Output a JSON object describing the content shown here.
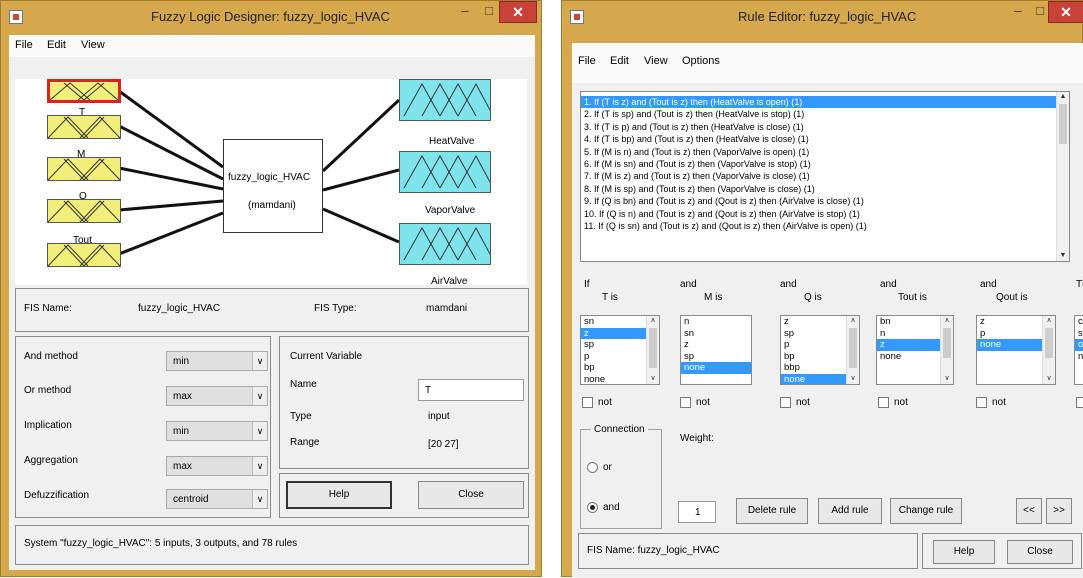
{
  "fld": {
    "title": "Fuzzy Logic Designer: fuzzy_logic_HVAC",
    "menu": [
      "File",
      "Edit",
      "View"
    ],
    "inputs": [
      "T",
      "M",
      "Q",
      "Tout"
    ],
    "fis_block": {
      "name": "fuzzy_logic_HVAC",
      "type": "(mamdani)"
    },
    "outputs": [
      "HeatValve",
      "VaporValve",
      "AirValve"
    ],
    "fis_name_label": "FIS Name:",
    "fis_name": "fuzzy_logic_HVAC",
    "fis_type_label": "FIS Type:",
    "fis_type": "mamdani",
    "methods": [
      {
        "label": "And method",
        "value": "min"
      },
      {
        "label": "Or method",
        "value": "max"
      },
      {
        "label": "Implication",
        "value": "min"
      },
      {
        "label": "Aggregation",
        "value": "max"
      },
      {
        "label": "Defuzzification",
        "value": "centroid"
      }
    ],
    "current_variable": {
      "heading": "Current Variable",
      "name_label": "Name",
      "name_value": "T",
      "type_label": "Type",
      "type_value": "input",
      "range_label": "Range",
      "range_value": "[20 27]"
    },
    "help": "Help",
    "close": "Close",
    "status": "System \"fuzzy_logic_HVAC\": 5 inputs, 3 outputs, and 78 rules"
  },
  "re": {
    "title": "Rule Editor: fuzzy_logic_HVAC",
    "menu": [
      "File",
      "Edit",
      "View",
      "Options"
    ],
    "rules": [
      "1. If (T is z) and (Tout is z) then (HeatValve is open) (1)",
      "2. If (T is sp) and (Tout is z) then (HeatValve is stop) (1)",
      "3. If (T is p) and (Tout is z) then (HeatValve is close) (1)",
      "4. If (T is bp) and (Tout is z) then (HeatValve is close) (1)",
      "5. If (M is n) and (Tout is z) then (VaporValve is open) (1)",
      "6. If (M is sn) and (Tout is z) then (VaporValve is stop) (1)",
      "7. If (M is z) and (Tout is z) then (VaporValve is close) (1)",
      "8. If (M is sp) and (Tout is z) then (VaporValve is close) (1)",
      "9. If (Q is bn) and (Tout is z) and (Qout is z) then (AirValve is close) (1)",
      "10. If (Q is n) and (Tout is z) and (Qout is z) then (AirValve is stop) (1)",
      "11. If (Q is sn) and (Tout is z) and (Qout is z) then (AirValve is open) (1)"
    ],
    "if": "If",
    "and": "and",
    "then_short": "Th",
    "columns": [
      {
        "label": "T is",
        "items": [
          "sn",
          "z",
          "sp",
          "p",
          "bp",
          "none"
        ],
        "selected": "z"
      },
      {
        "label": "M is",
        "items": [
          "n",
          "sn",
          "z",
          "sp",
          "none"
        ],
        "selected": "none"
      },
      {
        "label": "Q is",
        "items": [
          "z",
          "sp",
          "p",
          "bp",
          "bbp",
          "none"
        ],
        "selected": "none"
      },
      {
        "label": "Tout is",
        "items": [
          "bn",
          "n",
          "z",
          "none"
        ],
        "selected": "z"
      },
      {
        "label": "Qout is",
        "items": [
          "z",
          "p",
          "none"
        ],
        "selected": "none"
      }
    ],
    "partial_column": [
      "cl",
      "st",
      "op",
      "no"
    ],
    "not": "not",
    "connection": "Connection",
    "or": "or",
    "and_opt": "and",
    "weight_label": "Weight:",
    "weight": "1",
    "delete_rule": "Delete rule",
    "add_rule": "Add rule",
    "change_rule": "Change rule",
    "prev": "<<",
    "next": ">>",
    "fis_name": "FIS Name: fuzzy_logic_HVAC",
    "help": "Help",
    "close": "Close"
  },
  "colors": {
    "frame": "#d6a84e",
    "close": "#c8423a",
    "selection": "#3399ff",
    "mf_input": "#f2ee7a",
    "mf_output": "#7fe3ec"
  }
}
